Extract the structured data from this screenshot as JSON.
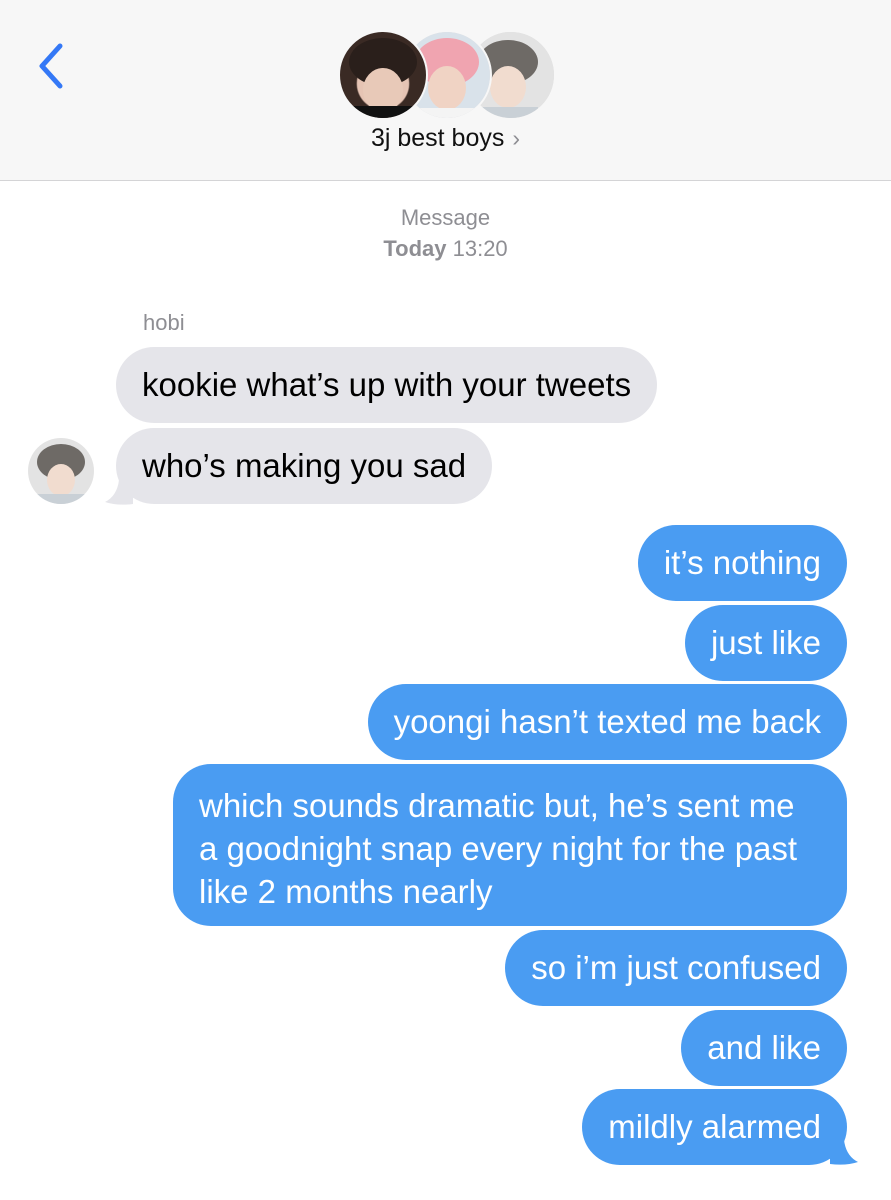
{
  "header": {
    "back_icon": "chevron-left-icon",
    "group_name": "3j best boys",
    "title_chevron": "›",
    "accent_color": "#3478f6"
  },
  "timestamp": {
    "label": "Message",
    "day": "Today",
    "time": "13:20"
  },
  "thread": {
    "sender_name": "hobi",
    "incoming": [
      "kookie what’s up with your tweets",
      "who’s making you sad"
    ],
    "outgoing": [
      "it’s nothing",
      "just like",
      "yoongi hasn’t texted me back",
      "which sounds dramatic but, he’s sent me a goodnight snap every night for the past like 2 months nearly",
      "so i’m just confused",
      "and like",
      "mildly alarmed"
    ],
    "incoming_color": "#e5e5ea",
    "outgoing_color": "#4a9cf2"
  }
}
